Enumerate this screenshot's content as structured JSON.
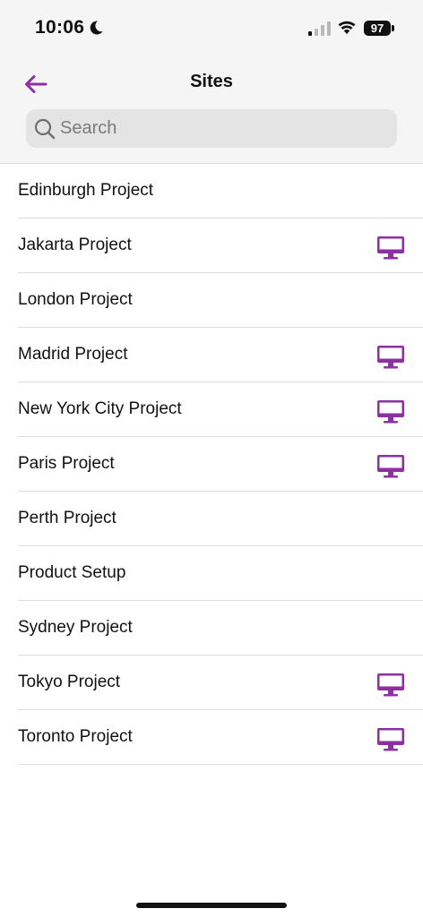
{
  "status_bar": {
    "time": "10:06",
    "battery": "97"
  },
  "nav": {
    "title": "Sites"
  },
  "search": {
    "placeholder": "Search",
    "value": ""
  },
  "colors": {
    "accent": "#8e2fa3",
    "header_bg": "#f5f5f5"
  },
  "sites": [
    {
      "label": "Edinburgh Project",
      "icon": ""
    },
    {
      "label": "Jakarta Project",
      "icon": "desktop-icon"
    },
    {
      "label": "London Project",
      "icon": ""
    },
    {
      "label": "Madrid Project",
      "icon": "desktop-icon"
    },
    {
      "label": "New York City Project",
      "icon": "desktop-icon"
    },
    {
      "label": "Paris Project",
      "icon": "desktop-icon"
    },
    {
      "label": "Perth Project",
      "icon": ""
    },
    {
      "label": "Product Setup",
      "icon": ""
    },
    {
      "label": "Sydney Project",
      "icon": ""
    },
    {
      "label": "Tokyo Project",
      "icon": "desktop-icon"
    },
    {
      "label": "Toronto Project",
      "icon": "desktop-icon"
    }
  ]
}
